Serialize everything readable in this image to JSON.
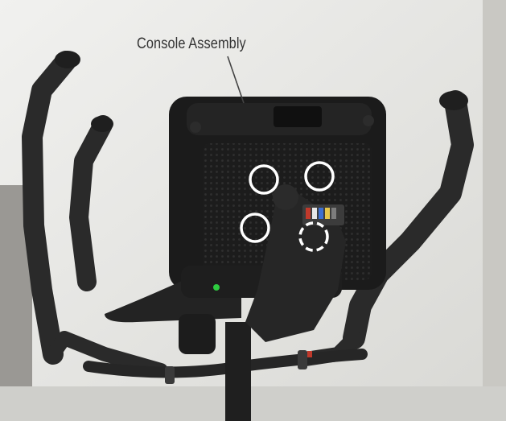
{
  "callout": {
    "label": "Console Assembly"
  },
  "markers": {
    "solid_circles": 3,
    "dashed_circles": 1
  },
  "colors": {
    "marker_stroke": "#ffffff",
    "indicator_light": "#2ecc40",
    "connector_red": "#c0392b"
  }
}
